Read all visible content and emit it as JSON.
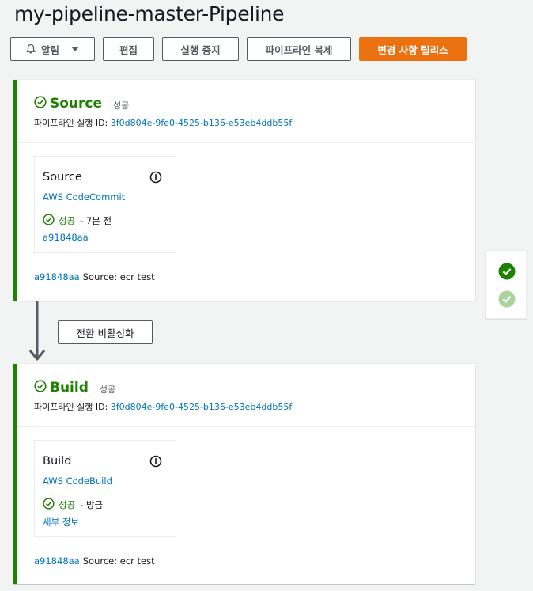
{
  "page": {
    "title": "my-pipeline-master-Pipeline"
  },
  "toolbar": {
    "notify_label": "알림",
    "edit_label": "편집",
    "stop_label": "실행 중지",
    "clone_label": "파이프라인 복제",
    "release_label": "변경 사항 릴리스"
  },
  "transition": {
    "disable_label": "전환 비활성화"
  },
  "stages": [
    {
      "name": "Source",
      "status": "성공",
      "execution_prefix": "파이프라인 실행 ID:",
      "execution_id": "3f0d804e-9fe0-4525-b136-e53eb4ddb55f",
      "action": {
        "name": "Source",
        "provider": "AWS CodeCommit",
        "status": "성공",
        "time": "- 7분 전",
        "sub_link": "a91848aa"
      },
      "revision_id": "a91848aa",
      "revision_text": "Source: ecr test"
    },
    {
      "name": "Build",
      "status": "성공",
      "execution_prefix": "파이프라인 실행 ID:",
      "execution_id": "3f0d804e-9fe0-4525-b136-e53eb4ddb55f",
      "action": {
        "name": "Build",
        "provider": "AWS CodeBuild",
        "status": "성공",
        "time": "- 방금",
        "sub_link": "세부 정보"
      },
      "revision_id": "a91848aa",
      "revision_text": "Source: ecr test"
    }
  ],
  "colors": {
    "success": "#1d8102",
    "link": "#0073bb",
    "primary": "#ec7211"
  },
  "icons": [
    "bell-icon",
    "caret-down-icon",
    "check-circle-icon",
    "info-icon",
    "arrow-down-icon"
  ]
}
